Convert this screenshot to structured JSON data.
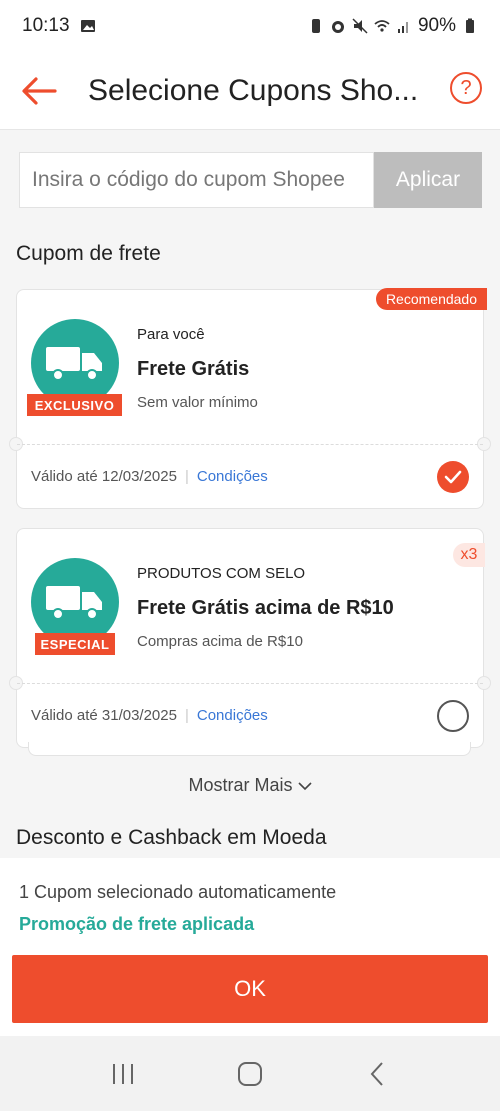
{
  "status_bar": {
    "time": "10:13",
    "battery": "90%"
  },
  "header": {
    "title": "Selecione Cupons Sho...",
    "help_symbol": "?"
  },
  "coupon_input": {
    "placeholder": "Insira o código do cupom Shopee",
    "value": "",
    "apply_label": "Aplicar"
  },
  "sections": {
    "shipping_title": "Cupom de frete",
    "coin_title": "Desconto e Cashback em Moeda"
  },
  "vouchers": [
    {
      "badge": "Recomendado",
      "tag": "EXCLUSIVO",
      "label": "Para você",
      "title": "Frete Grátis",
      "subtitle": "Sem valor mínimo",
      "validity": "Válido até 12/03/2025",
      "conditions": "Condições",
      "selected": true
    },
    {
      "badge": "x3",
      "tag": "ESPECIAL",
      "label": "PRODUTOS COM SELO",
      "title": "Frete Grátis acima de R$10",
      "subtitle": "Compras acima de R$10",
      "validity": "Válido até 31/03/2025",
      "conditions": "Condições",
      "selected": false
    }
  ],
  "show_more": "Mostrar Mais",
  "footer": {
    "auto_selected": "1 Cupom selecionado automaticamente",
    "promo_applied": "Promoção de frete aplicada",
    "ok_label": "OK"
  },
  "colors": {
    "accent": "#ee4d2d",
    "teal": "#26aa99",
    "link": "#3977d6"
  },
  "icons": {
    "back": "arrow-left-icon",
    "help": "question-circle-icon",
    "truck": "truck-icon",
    "check": "check-icon",
    "chevron": "chevron-down-icon"
  }
}
